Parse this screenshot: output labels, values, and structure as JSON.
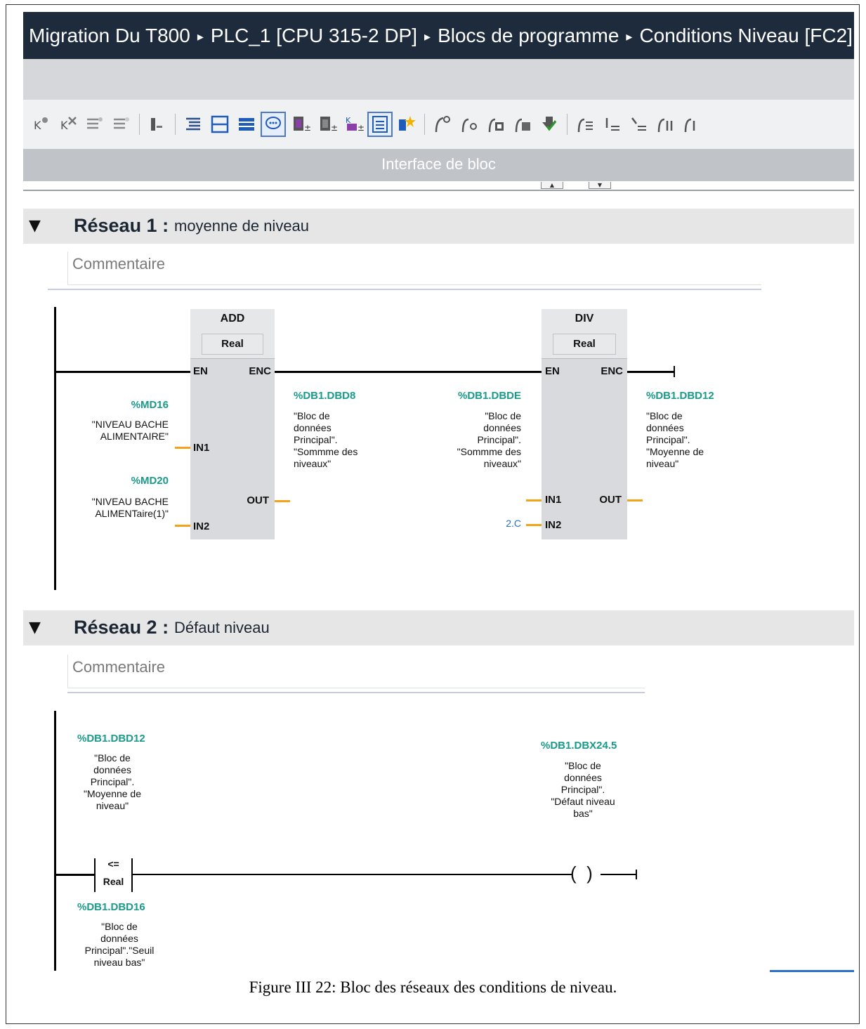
{
  "breadcrumb": {
    "items": [
      "Migration Du T800",
      "PLC_1 [CPU 315-2 DP]",
      "Blocs de programme",
      "Conditions Niveau [FC2]"
    ],
    "separator": "▸"
  },
  "interface_bar": {
    "label": "Interface de bloc"
  },
  "networks": [
    {
      "label": "Réseau 1 :",
      "title": "moyenne de niveau",
      "comment": "Commentaire",
      "add_box": {
        "op": "ADD",
        "type": "Real",
        "pins": {
          "en": "EN",
          "eno": "ENC",
          "in1": "IN1",
          "in2": "IN2",
          "out": "OUT"
        }
      },
      "div_box": {
        "op": "DIV",
        "type": "Real",
        "pins": {
          "en": "EN",
          "eno": "ENC",
          "in1": "IN1",
          "in2": "IN2",
          "out": "OUT"
        }
      },
      "add_in1": {
        "addr": "%MD16",
        "symbol": "\"NIVEAU BACHE\nALIMENTAIRE\""
      },
      "add_in2": {
        "addr": "%MD20",
        "symbol": "\"NIVEAU BACHE\nALIMENTaire(1)\""
      },
      "add_out": {
        "addr": "%DB1.DBD8",
        "symbol": "\"Bloc de\ndonnées\nPrincipal\".\n\"Sommme des\nniveaux\""
      },
      "div_in1": {
        "addr": "%DB1.DBDE",
        "symbol": "\"Bloc de\ndonnées\nPrincipal\".\n\"Sommme des\nniveaux\""
      },
      "div_in2": {
        "value": "2.C"
      },
      "div_out": {
        "addr": "%DB1.DBD12",
        "symbol": "\"Bloc de\ndonnées\nPrincipal\".\n\"Moyenne de\nniveau\""
      }
    },
    {
      "label": "Réseau 2 :",
      "title": "Défaut niveau",
      "comment": "Commentaire",
      "compare": {
        "op": "<=",
        "type": "Real"
      },
      "cmp_in1": {
        "addr": "%DB1.DBD12",
        "symbol": "\"Bloc de\ndonnées\nPrincipal\".\n\"Moyenne de\nniveau\""
      },
      "cmp_in2": {
        "addr": "%DB1.DBD16",
        "symbol": "\"Bloc de\ndonnées\nPrincipal\".\"Seuil\nniveau bas\""
      },
      "coil": {
        "addr": "%DB1.DBX24.5",
        "symbol": "\"Bloc de\ndonnées\nPrincipal\".\n\"Défaut niveau\nbas\""
      }
    }
  ],
  "caption": "Figure III 22: Bloc des réseaux des conditions de niveau."
}
